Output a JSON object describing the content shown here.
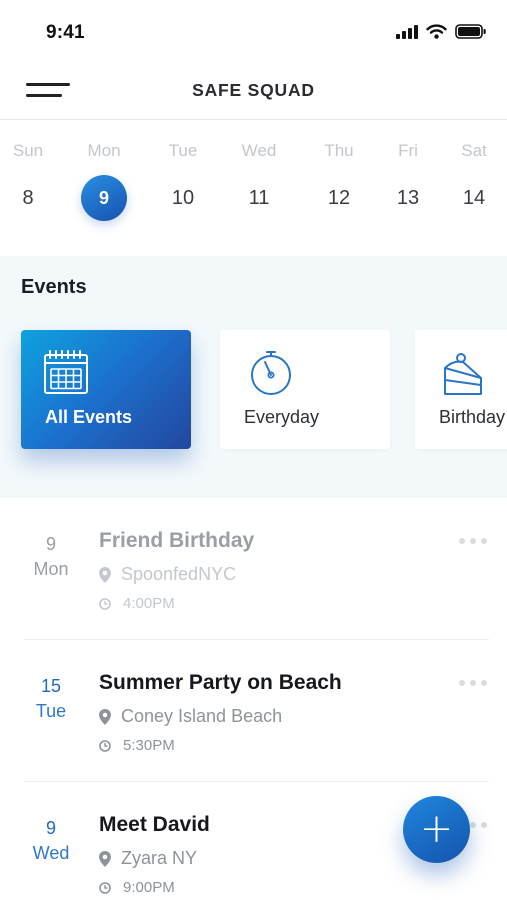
{
  "status_bar": {
    "time": "9:41",
    "icons": [
      "cellular-signal-icon",
      "wifi-icon",
      "battery-icon"
    ]
  },
  "header": {
    "title": "SAFE SQUAD",
    "menu_icon": "hamburger-menu-icon"
  },
  "week": {
    "selected_index": 1,
    "days": [
      {
        "name": "Sun",
        "num": "8"
      },
      {
        "name": "Mon",
        "num": "9"
      },
      {
        "name": "Tue",
        "num": "10"
      },
      {
        "name": "Wed",
        "num": "11"
      },
      {
        "name": "Thu",
        "num": "12"
      },
      {
        "name": "Fri",
        "num": "13"
      },
      {
        "name": "Sat",
        "num": "14"
      }
    ]
  },
  "events_section": {
    "heading": "Events",
    "categories": [
      {
        "label": "All Events",
        "icon": "calendar-icon",
        "active": true
      },
      {
        "label": "Everyday",
        "icon": "stopwatch-icon",
        "active": false
      },
      {
        "label": "Birthday",
        "icon": "cake-icon",
        "active": false
      }
    ]
  },
  "event_list": [
    {
      "date_num": "9",
      "date_day": "Mon",
      "title": "Friend Birthday",
      "location": "SpoonfedNYC",
      "time": "4:00PM",
      "state": "past"
    },
    {
      "date_num": "15",
      "date_day": "Tue",
      "title": "Summer Party on Beach",
      "location": "Coney Island Beach",
      "time": "5:30PM",
      "state": "upcoming"
    },
    {
      "date_num": "9",
      "date_day": "Wed",
      "title": "Meet David",
      "location": "Zyara NY",
      "time": "9:00PM",
      "state": "upcoming"
    }
  ],
  "fab": {
    "label": "+",
    "icon": "plus-icon"
  },
  "colors": {
    "accent": "#1c6fcc",
    "accent_dark": "#23479e",
    "panel_bg": "#f3f9fb",
    "muted_text": "#8e939b"
  }
}
